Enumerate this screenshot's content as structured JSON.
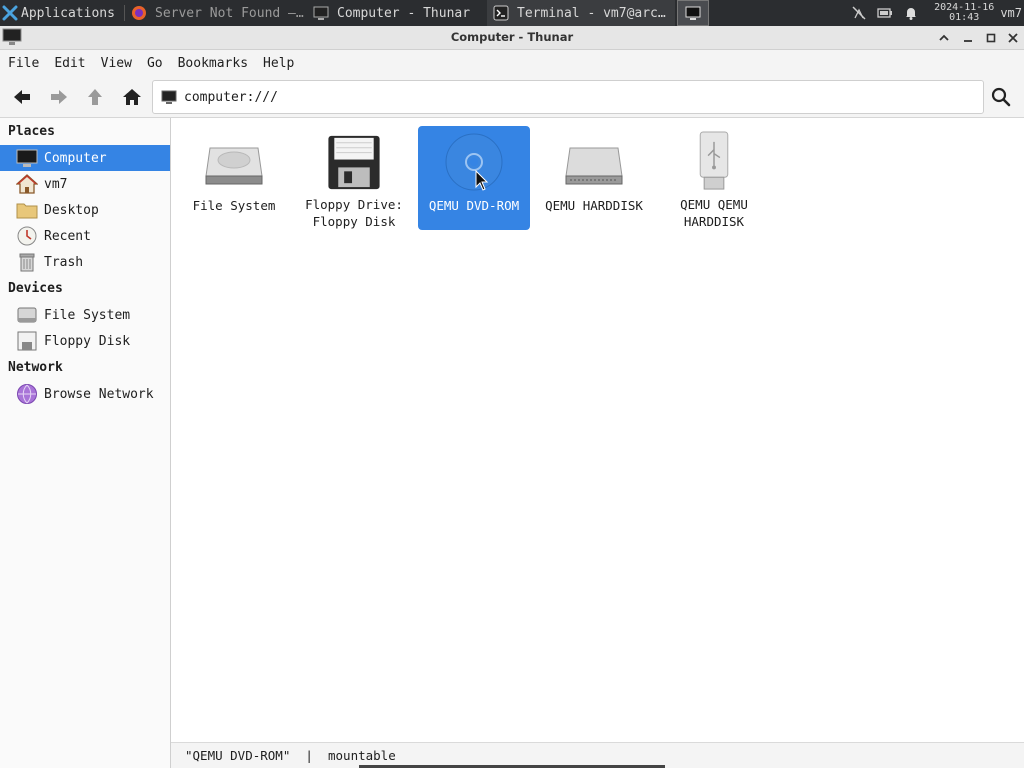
{
  "panel": {
    "applications_label": "Applications",
    "tasks": [
      {
        "label": "Server Not Found —…",
        "icon": "firefox-icon"
      },
      {
        "label": "Computer - Thunar",
        "icon": "computer-icon"
      },
      {
        "label": "Terminal - vm7@arc…",
        "icon": "terminal-icon"
      }
    ],
    "clock_date": "2024-11-16",
    "clock_time": "01:43",
    "user": "vm7"
  },
  "window": {
    "title": "Computer - Thunar"
  },
  "menu": [
    "File",
    "Edit",
    "View",
    "Go",
    "Bookmarks",
    "Help"
  ],
  "location": {
    "path": "computer:///"
  },
  "sidebar": {
    "places_header": "Places",
    "places": [
      {
        "label": "Computer",
        "icon": "computer-icon",
        "active": true
      },
      {
        "label": "vm7",
        "icon": "home-icon"
      },
      {
        "label": "Desktop",
        "icon": "folder-icon"
      },
      {
        "label": "Recent",
        "icon": "recent-icon"
      },
      {
        "label": "Trash",
        "icon": "trash-icon"
      }
    ],
    "devices_header": "Devices",
    "devices": [
      {
        "label": "File System",
        "icon": "harddisk-icon"
      },
      {
        "label": "Floppy Disk",
        "icon": "floppy-icon"
      }
    ],
    "network_header": "Network",
    "network": [
      {
        "label": "Browse Network",
        "icon": "network-icon"
      }
    ]
  },
  "items": [
    {
      "label": "File System",
      "icon": "harddisk-icon"
    },
    {
      "label": "Floppy Drive:\nFloppy Disk",
      "icon": "floppy-icon"
    },
    {
      "label": "QEMU DVD-ROM",
      "icon": "optical-disc-icon",
      "selected": true
    },
    {
      "label": "QEMU HARDDISK",
      "icon": "harddisk-icon"
    },
    {
      "label": "QEMU QEMU\nHARDDISK",
      "icon": "usb-drive-icon"
    }
  ],
  "status": {
    "text": "\"QEMU DVD-ROM\"  |  mountable"
  },
  "colors": {
    "accent": "#3584e4",
    "panel": "#2b2d30"
  }
}
